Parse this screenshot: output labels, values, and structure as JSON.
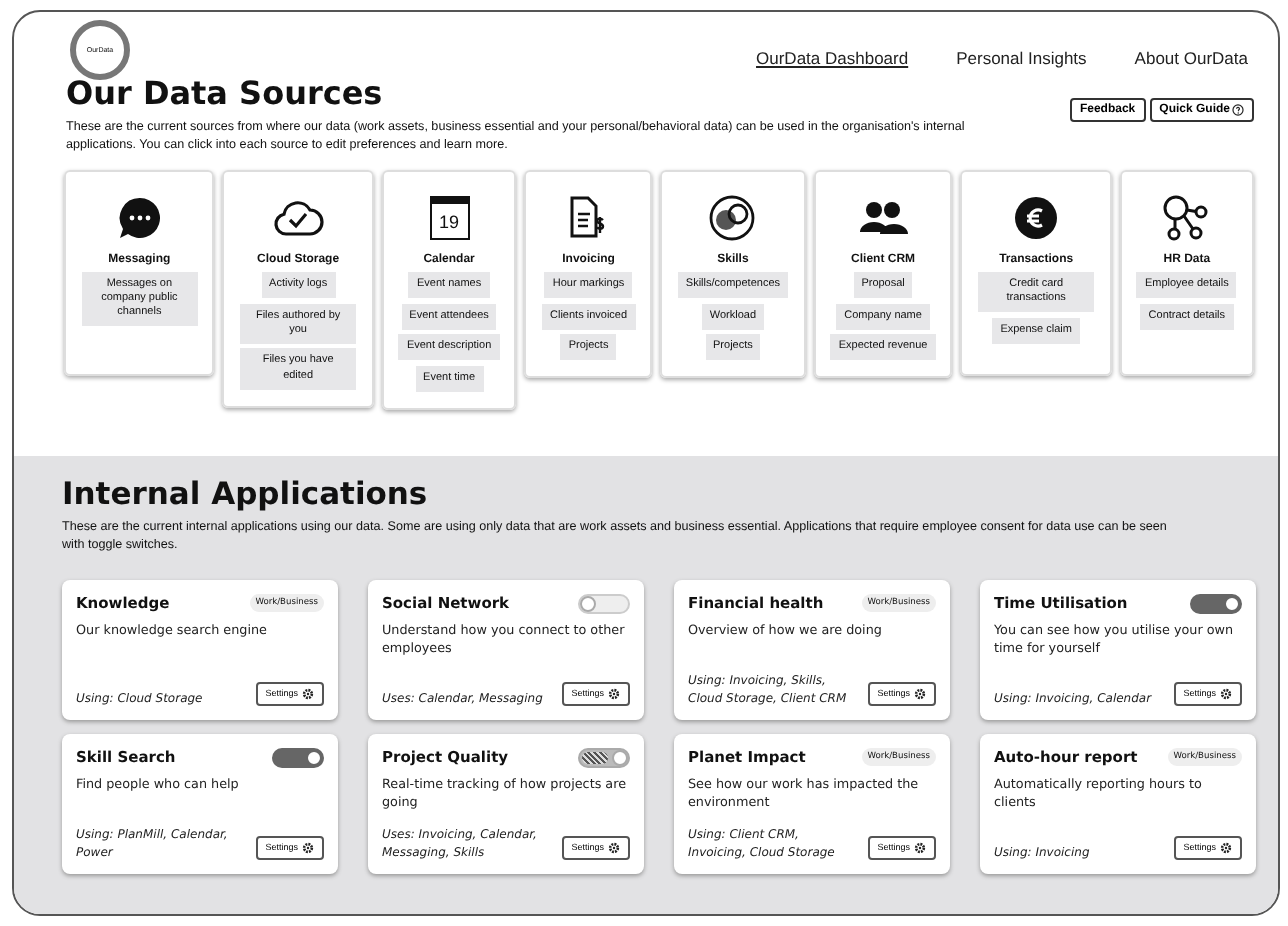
{
  "logo": {
    "text": "OurData"
  },
  "nav": [
    {
      "label": "OurData Dashboard",
      "selected": true
    },
    {
      "label": "Personal Insights",
      "selected": false
    },
    {
      "label": "About OurData",
      "selected": false
    }
  ],
  "sources_section": {
    "title": "Our Data Sources",
    "description": "These are the current sources from where our data (work assets, business essential  and your personal/behavioral data) can be used in the organisation's internal applications. You can click into each source to edit preferences and learn more.",
    "buttons": [
      {
        "label": "Feedback",
        "kind": "plain"
      },
      {
        "label": "Quick Guide",
        "kind": "help"
      }
    ]
  },
  "sources": [
    {
      "name": "Messaging",
      "items": [
        "Messages on company public channels"
      ]
    },
    {
      "name": "Cloud Storage",
      "items": [
        "Activity logs",
        "Files authored by you",
        "Files you have edited"
      ]
    },
    {
      "name": "Calendar",
      "icon_text": "19",
      "items": [
        "Event names",
        "Event attendees",
        "Event description",
        "Event time"
      ]
    },
    {
      "name": "Invoicing",
      "items": [
        "Hour markings",
        "Clients invoiced",
        "Projects"
      ]
    },
    {
      "name": "Skills",
      "items": [
        "Skills/competences",
        "Workload",
        "Projects"
      ]
    },
    {
      "name": "Client CRM",
      "items": [
        "Proposal",
        "Company name",
        "Expected revenue"
      ]
    },
    {
      "name": "Transactions",
      "items": [
        "Credit card transactions",
        "Expense claim"
      ]
    },
    {
      "name": "HR Data",
      "items": [
        "Employee details",
        "Contract details"
      ]
    }
  ],
  "apps_section": {
    "title": "Internal Applications",
    "description": "These are the current internal applications using our data. Some are using only data that are work assets and business essential. Applications that require employee consent for data use can be seen with toggle switches."
  },
  "apps": [
    {
      "name": "Knowledge",
      "kind": "badge",
      "badge": "Work/Business",
      "description": "Our knowledge search engine",
      "usage": "Using: Cloud Storage",
      "button": "Settings"
    },
    {
      "name": "Social Network",
      "kind": "toggle",
      "on": false,
      "pending": false,
      "description": "Understand how you connect to other employees",
      "usage": "Uses: Calendar, Messaging",
      "button": "Settings"
    },
    {
      "name": "Financial health",
      "kind": "badge",
      "badge": "Work/Business",
      "description": "Overview of how we are doing",
      "usage": "Using: Invoicing, Skills, Cloud Storage, Client CRM",
      "button": "Settings"
    },
    {
      "name": "Time Utilisation",
      "kind": "toggle",
      "on": true,
      "pending": false,
      "description": "You can see how you utilise your own time for yourself",
      "usage": "Using: Invoicing, Calendar",
      "button": "Settings"
    },
    {
      "name": "Skill Search",
      "kind": "toggle",
      "on": true,
      "pending": false,
      "description": "Find people who can help",
      "usage": "Using: PlanMill, Calendar, Power",
      "button": "Settings"
    },
    {
      "name": "Project Quality",
      "kind": "toggle",
      "on": true,
      "pending": true,
      "description": "Real-time  tracking of how projects are going",
      "usage": "Uses: Invoicing, Calendar, Messaging, Skills",
      "button": "Settings"
    },
    {
      "name": "Planet Impact",
      "kind": "badge",
      "badge": "Work/Business",
      "description": "See how our work has impacted the environment",
      "usage": "Using: Client CRM, Invoicing, Cloud Storage",
      "button": "Settings"
    },
    {
      "name": "Auto-hour report",
      "kind": "badge",
      "badge": "Work/Business",
      "description": "Automatically reporting hours to clients",
      "usage": "Using: Invoicing",
      "button": "Settings"
    }
  ]
}
